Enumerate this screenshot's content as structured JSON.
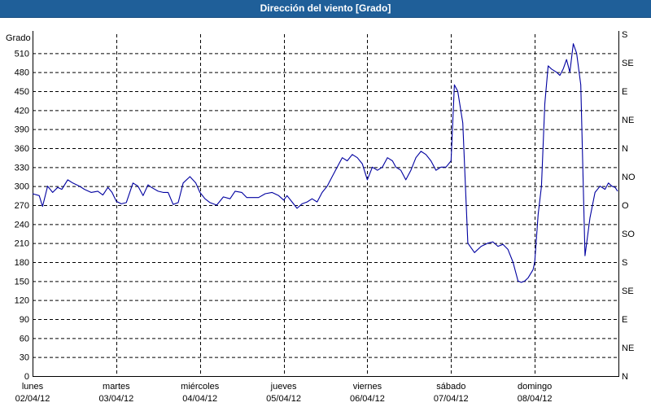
{
  "chart_data": {
    "type": "line",
    "title": "Dirección del viento [Grado]",
    "ylabel": "Grado",
    "ylim": [
      0,
      540
    ],
    "yticks": [
      0,
      30,
      60,
      90,
      120,
      150,
      180,
      210,
      240,
      270,
      300,
      330,
      360,
      390,
      420,
      450,
      480,
      510
    ],
    "grid": true,
    "right_axis": {
      "labels": [
        "N",
        "NE",
        "E",
        "SE",
        "S",
        "SO",
        "O",
        "NO",
        "N",
        "NE",
        "E",
        "SE",
        "S"
      ],
      "values": [
        0,
        45,
        90,
        135,
        180,
        225,
        270,
        315,
        360,
        405,
        450,
        495,
        540
      ]
    },
    "days": [
      {
        "name": "lunes",
        "date": "02/04/12"
      },
      {
        "name": "martes",
        "date": "03/04/12"
      },
      {
        "name": "miércoles",
        "date": "04/04/12"
      },
      {
        "name": "jueves",
        "date": "05/04/12"
      },
      {
        "name": "viernes",
        "date": "06/04/12"
      },
      {
        "name": "sábado",
        "date": "07/04/12"
      },
      {
        "name": "domingo",
        "date": "08/04/12"
      }
    ],
    "series": [
      {
        "color": "#0000a0",
        "x_days": [
          0,
          0.08,
          0.12,
          0.18,
          0.24,
          0.3,
          0.35,
          0.42,
          0.48,
          0.56,
          0.62,
          0.7,
          0.78,
          0.84,
          0.9,
          0.95,
          1.0,
          1.06,
          1.12,
          1.2,
          1.26,
          1.32,
          1.38,
          1.42,
          1.5,
          1.56,
          1.62,
          1.68,
          1.74,
          1.8,
          1.88,
          1.95,
          2.0,
          2.06,
          2.12,
          2.2,
          2.28,
          2.36,
          2.42,
          2.5,
          2.56,
          2.62,
          2.7,
          2.78,
          2.86,
          2.94,
          3.0,
          3.04,
          3.1,
          3.16,
          3.22,
          3.28,
          3.34,
          3.4,
          3.46,
          3.52,
          3.58,
          3.64,
          3.7,
          3.76,
          3.82,
          3.88,
          3.94,
          4.0,
          4.06,
          4.12,
          4.18,
          4.24,
          4.3,
          4.34,
          4.4,
          4.46,
          4.52,
          4.58,
          4.64,
          4.7,
          4.76,
          4.82,
          4.88,
          4.94,
          5.0,
          5.04,
          5.08,
          5.14,
          5.2,
          5.28,
          5.36,
          5.44,
          5.5,
          5.56,
          5.62,
          5.68,
          5.74,
          5.8,
          5.84,
          5.88,
          5.92,
          5.98,
          6.0,
          6.04,
          6.08,
          6.12,
          6.16,
          6.2,
          6.26,
          6.3,
          6.34,
          6.38,
          6.42,
          6.46,
          6.5,
          6.55,
          6.6,
          6.66,
          6.72,
          6.78,
          6.84,
          6.88,
          6.92,
          6.96,
          6.99
        ],
        "values": [
          288,
          285,
          268,
          300,
          290,
          298,
          295,
          310,
          305,
          300,
          295,
          290,
          292,
          286,
          298,
          290,
          276,
          272,
          274,
          305,
          300,
          285,
          302,
          298,
          292,
          290,
          290,
          271,
          274,
          305,
          315,
          305,
          290,
          280,
          274,
          270,
          283,
          280,
          292,
          290,
          282,
          282,
          282,
          288,
          290,
          285,
          278,
          285,
          275,
          265,
          272,
          275,
          280,
          275,
          290,
          300,
          315,
          330,
          345,
          340,
          350,
          345,
          335,
          310,
          330,
          325,
          330,
          345,
          340,
          330,
          325,
          310,
          325,
          345,
          355,
          350,
          340,
          325,
          330,
          330,
          340,
          460,
          450,
          400,
          210,
          195,
          205,
          210,
          212,
          205,
          208,
          200,
          180,
          150,
          148,
          150,
          155,
          168,
          180,
          255,
          300,
          430,
          490,
          485,
          480,
          475,
          485,
          500,
          480,
          525,
          510,
          460,
          190,
          250,
          290,
          300,
          295,
          305,
          300,
          298,
          292
        ]
      }
    ]
  }
}
